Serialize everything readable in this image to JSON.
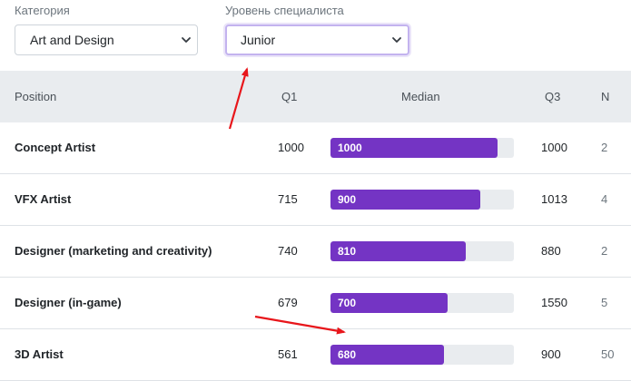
{
  "filters": {
    "category": {
      "label": "Категория",
      "value": "Art and Design",
      "icon": "chevron-down-icon"
    },
    "level": {
      "label": "Уровень специалиста",
      "value": "Junior",
      "icon": "chevron-down-icon",
      "focus_color": "#c3b3ef"
    }
  },
  "table": {
    "headers": {
      "position": "Position",
      "q1": "Q1",
      "median": "Median",
      "q3": "Q3",
      "n": "N"
    },
    "bar_color": "#7434c4",
    "median_scale_max": 1100,
    "rows": [
      {
        "position": "Concept Artist",
        "q1": "1000",
        "median": "1000",
        "median_value": 1000,
        "q3": "1000",
        "n": "2"
      },
      {
        "position": "VFX Artist",
        "q1": "715",
        "median": "900",
        "median_value": 900,
        "q3": "1013",
        "n": "4"
      },
      {
        "position": "Designer (marketing and creativity)",
        "q1": "740",
        "median": "810",
        "median_value": 810,
        "q3": "880",
        "n": "2"
      },
      {
        "position": "Designer (in-game)",
        "q1": "679",
        "median": "700",
        "median_value": 700,
        "q3": "1550",
        "n": "5"
      },
      {
        "position": "3D Artist",
        "q1": "561",
        "median": "680",
        "median_value": 680,
        "q3": "900",
        "n": "50"
      }
    ]
  },
  "annotations": {
    "arrow_color": "#e8161b",
    "arrows": [
      "red-arrow-to-level-select",
      "red-arrow-to-3d-artist-median"
    ]
  }
}
